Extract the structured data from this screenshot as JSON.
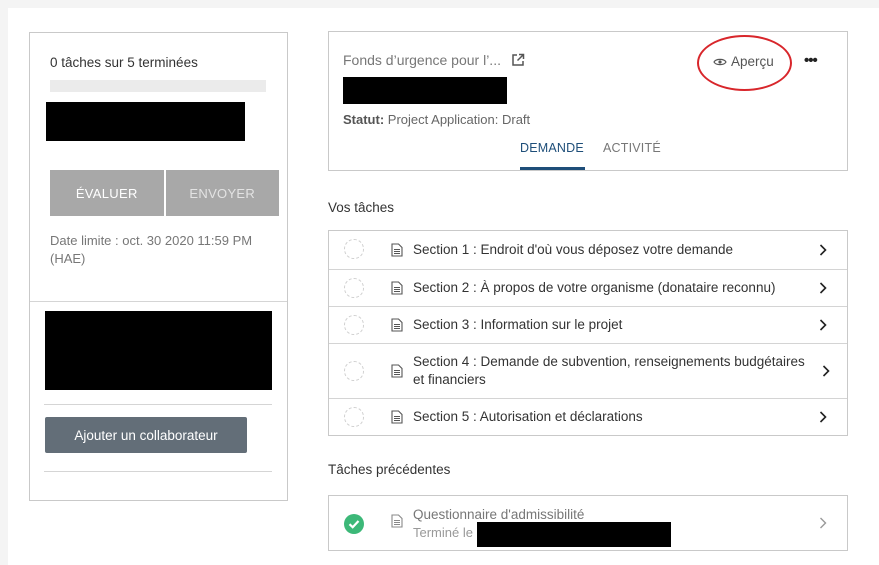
{
  "sidebar": {
    "tasks_progress_text": "0 tâches sur 5 terminées",
    "progress_fraction": 0,
    "evaluate_label": "ÉVALUER",
    "send_label": "ENVOYER",
    "deadline_text": "Date limite : oct. 30 2020 11:59 PM (HAE)",
    "add_collaborator_label": "Ajouter un collaborateur"
  },
  "application": {
    "title": "Fonds d’urgence pour l’...",
    "status_label": "Statut:",
    "status_value": "Project Application: Draft",
    "preview_label": "Aperçu",
    "more_label": "•••",
    "tabs": [
      {
        "label": "DEMANDE",
        "active": true
      },
      {
        "label": "ACTIVITÉ",
        "active": false
      }
    ]
  },
  "tasks": {
    "heading": "Vos tâches",
    "items": [
      {
        "label": "Section 1 : Endroit d'où vous déposez votre demande"
      },
      {
        "label": "Section 2 : À propos de votre organisme (donataire reconnu)"
      },
      {
        "label": "Section 3 : Information sur le projet"
      },
      {
        "label": "Section 4 : Demande de subvention, renseignements budgétaires et financiers"
      },
      {
        "label": "Section 5 : Autorisation et déclarations"
      }
    ]
  },
  "previous_tasks": {
    "heading": "Tâches précédentes",
    "items": [
      {
        "title": "Questionnaire d'admissibilité",
        "subtitle": "Terminé le"
      }
    ]
  },
  "colors": {
    "accent": "#1e4e79",
    "annotation": "#d8262b",
    "success": "#3cb878",
    "button_grey": "#a8a8a8",
    "button_dark": "#636e78"
  }
}
